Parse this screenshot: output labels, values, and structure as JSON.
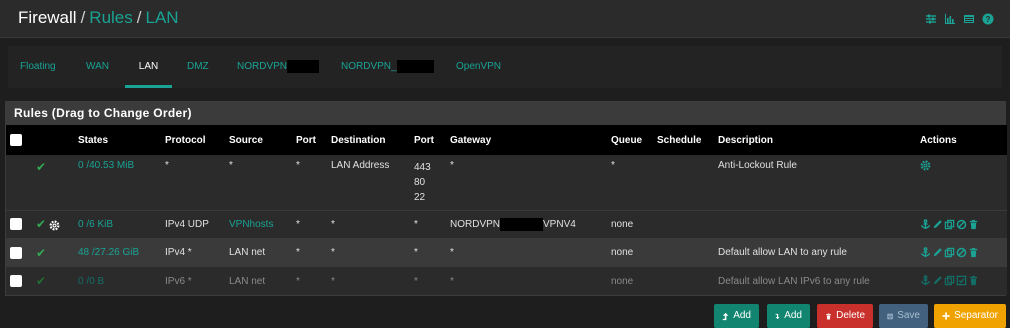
{
  "breadcrumb": {
    "root": "Firewall",
    "sep1": "/",
    "rules": "Rules",
    "sep2": "/",
    "current": "LAN"
  },
  "header_icons": [
    "sliders-icon",
    "chart-icon",
    "list-icon",
    "help-icon"
  ],
  "tabs": [
    {
      "label": "Floating"
    },
    {
      "label": "WAN"
    },
    {
      "label": "LAN",
      "active": true
    },
    {
      "label": "DMZ"
    },
    {
      "label": "NORDVPN"
    },
    {
      "label": "NORDVPN_"
    },
    {
      "label": "OpenVPN"
    }
  ],
  "panel": {
    "title": "Rules (Drag to Change Order)"
  },
  "columns": [
    "States",
    "Protocol",
    "Source",
    "Port",
    "Destination",
    "Port",
    "Gateway",
    "Queue",
    "Schedule",
    "Description",
    "Actions"
  ],
  "rows": [
    {
      "states": "0 /40.53 MiB",
      "protocol": "*",
      "source": "*",
      "port": "*",
      "destination": "LAN Address",
      "dport1": "443",
      "dport2": "80",
      "dport3": "22",
      "gateway": "*",
      "queue": "*",
      "schedule": "",
      "description": "Anti-Lockout Rule"
    },
    {
      "states": "0 /6 KiB",
      "protocol": "IPv4 UDP",
      "source": "VPNhosts",
      "port": "*",
      "destination": "*",
      "dport": "*",
      "gateway_prefix": "NORDVPN",
      "gateway_suffix": "VPNV4",
      "queue": "none",
      "schedule": "",
      "description": ""
    },
    {
      "states": "48 /27.26 GiB",
      "protocol": "IPv4 *",
      "source": "LAN net",
      "port": "*",
      "destination": "*",
      "dport": "*",
      "gateway": "*",
      "queue": "none",
      "schedule": "",
      "description": "Default allow LAN to any rule"
    },
    {
      "states": "0 /0 B",
      "protocol": "IPv6 *",
      "source": "LAN net",
      "port": "*",
      "destination": "*",
      "dport": "*",
      "gateway": "*",
      "queue": "none",
      "schedule": "",
      "description": "Default allow LAN IPv6 to any rule"
    }
  ],
  "buttons": {
    "add_top": "Add",
    "add_bottom": "Add",
    "delete": "Delete",
    "save": "Save",
    "separator": "Separator"
  },
  "colors": {
    "accent": "#1aa394",
    "check": "#32a852",
    "delete": "#c9302c",
    "separator": "#f0a300"
  }
}
